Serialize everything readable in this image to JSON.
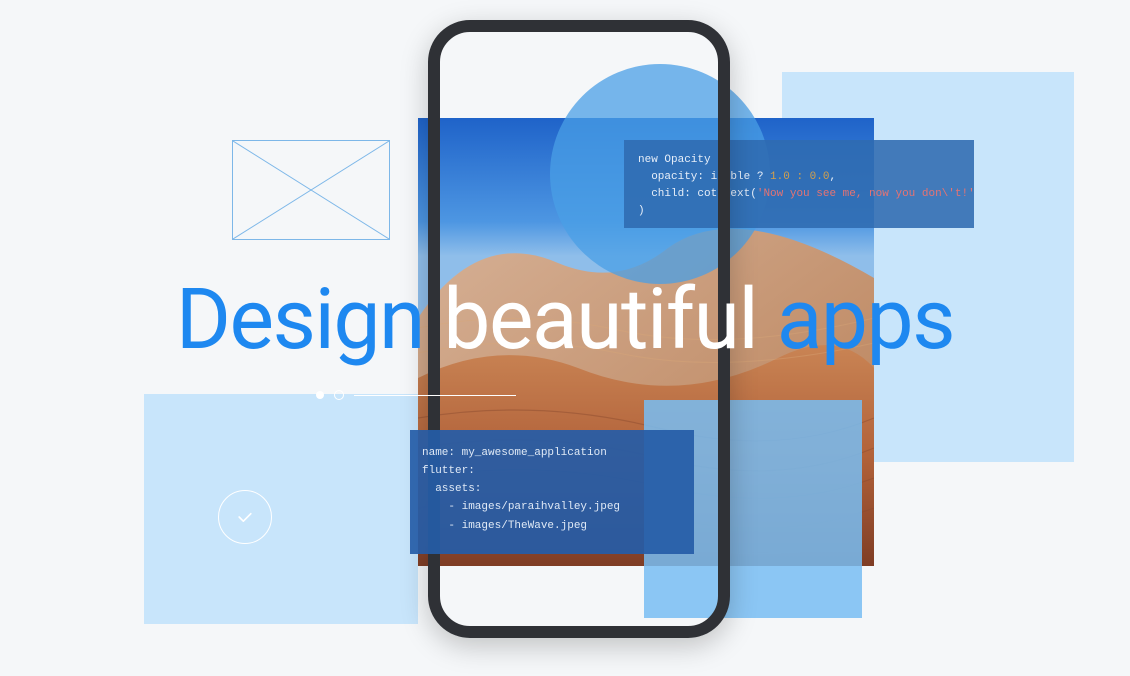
{
  "headline": {
    "word1": "Design",
    "word2": "beautiful",
    "word3": "apps"
  },
  "code_top": {
    "line1_a": "new Opacity",
    "line2_a": "  opacity: ",
    "line2_b": "isible ? ",
    "line2_num": "1.0 : 0.0",
    "line2_c": ",",
    "line3_a": "  child: co",
    "line3_b": "t Text(",
    "line3_str": "'Now you see me, now you don\\'t!'",
    "line3_c": "),",
    "line4": ")"
  },
  "code_bottom": {
    "line1": "name: my_awesome_application",
    "line2": "flutter:",
    "line3": "  assets:",
    "line4": "    - images/paraihvalley.jpeg",
    "line5": "    - images/TheWave.jpeg"
  }
}
